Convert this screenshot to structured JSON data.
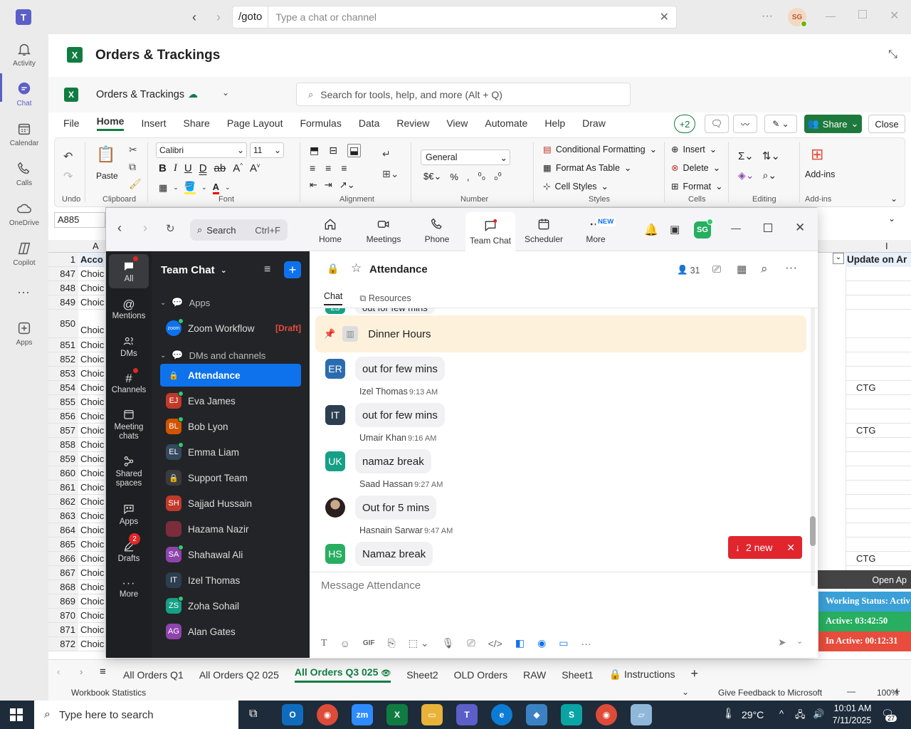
{
  "teams": {
    "search_prefix": "/goto",
    "search_placeholder": "Type a chat or channel",
    "user_initials": "SG",
    "rail": [
      {
        "label": "Activity",
        "icon": "bell-icon"
      },
      {
        "label": "Chat",
        "icon": "chat-icon"
      },
      {
        "label": "Calendar",
        "icon": "calendar-icon"
      },
      {
        "label": "Calls",
        "icon": "phone-icon"
      },
      {
        "label": "OneDrive",
        "icon": "cloud-icon"
      },
      {
        "label": "Copilot",
        "icon": "copilot-icon"
      },
      {
        "label": "Apps",
        "icon": "plus-box-icon"
      }
    ]
  },
  "excel": {
    "window_title": "Orders & Trackings",
    "doc_title": "Orders & Trackings",
    "search_placeholder": "Search for tools, help, and more (Alt + Q)",
    "menu_tabs": [
      "File",
      "Home",
      "Insert",
      "Share",
      "Page Layout",
      "Formulas",
      "Data",
      "Review",
      "View",
      "Automate",
      "Help",
      "Draw"
    ],
    "collab_count": "+2",
    "share_label": "Share",
    "close_label": "Close",
    "ribbon": {
      "undo_label": "Undo",
      "clipboard_label": "Clipboard",
      "paste_label": "Paste",
      "font_label": "Font",
      "font_name": "Calibri",
      "font_size": "11",
      "alignment_label": "Alignment",
      "number_format": "General",
      "number_label": "Number",
      "conditional_formatting": "Conditional Formatting",
      "format_as_table": "Format As Table",
      "cell_styles": "Cell Styles",
      "styles_label": "Styles",
      "insert": "Insert",
      "delete": "Delete",
      "format": "Format",
      "cells_label": "Cells",
      "editing_label": "Editing",
      "addins": "Add-ins",
      "addins_label": "Add-ins"
    },
    "name_box": "A885",
    "col_a": "A",
    "col_i": "I",
    "row1_num": "1",
    "row1_a": "Acco",
    "row1_i": "Update on Ar",
    "rows": [
      {
        "n": "847",
        "a": "Choic",
        "i": ""
      },
      {
        "n": "848",
        "a": "Choic",
        "i": ""
      },
      {
        "n": "849",
        "a": "Choic",
        "i": ""
      },
      {
        "n": "850",
        "a": "Choic",
        "i": ""
      },
      {
        "n": "851",
        "a": "Choic",
        "i": ""
      },
      {
        "n": "852",
        "a": "Choic",
        "i": ""
      },
      {
        "n": "853",
        "a": "Choic",
        "i": ""
      },
      {
        "n": "854",
        "a": "Choic",
        "i": "CTG"
      },
      {
        "n": "855",
        "a": "Choic",
        "i": ""
      },
      {
        "n": "856",
        "a": "Choic",
        "i": ""
      },
      {
        "n": "857",
        "a": "Choic",
        "i": "CTG"
      },
      {
        "n": "858",
        "a": "Choic",
        "i": ""
      },
      {
        "n": "859",
        "a": "Choic",
        "i": ""
      },
      {
        "n": "860",
        "a": "Choic",
        "i": ""
      },
      {
        "n": "861",
        "a": "Choic",
        "i": ""
      },
      {
        "n": "862",
        "a": "Choic",
        "i": ""
      },
      {
        "n": "863",
        "a": "Choic",
        "i": ""
      },
      {
        "n": "864",
        "a": "Choic",
        "i": ""
      },
      {
        "n": "865",
        "a": "Choic",
        "i": ""
      },
      {
        "n": "866",
        "a": "Choic",
        "i": "CTG"
      },
      {
        "n": "867",
        "a": "Choic",
        "i": ""
      },
      {
        "n": "868",
        "a": "Choic",
        "i": ""
      },
      {
        "n": "869",
        "a": "Choic",
        "i": ""
      },
      {
        "n": "870",
        "a": "Choic",
        "i": ""
      },
      {
        "n": "871",
        "a": "Choic",
        "i": ""
      },
      {
        "n": "872",
        "a": "Choic",
        "i": ""
      }
    ],
    "open_app": "Open Ap",
    "working_status": "Working Status: Activ",
    "active_time": "Active: 03:42:50",
    "inactive_time": "In Active: 00:12:31",
    "sheets": [
      "All Orders Q1",
      "All Orders Q2 025",
      "All Orders Q3 025",
      "Sheet2",
      "OLD Orders",
      "RAW",
      "Sheet1",
      "Instructions"
    ],
    "status_left": "Workbook Statistics",
    "feedback": "Give Feedback to Microsoft",
    "zoom_level": "100%",
    "colors": {
      "excel_green": "#107c41",
      "share_green": "#1e7a3c"
    }
  },
  "zoom": {
    "search_label": "Search",
    "search_shortcut": "Ctrl+F",
    "nav": [
      {
        "label": "Home",
        "icon": "home-icon"
      },
      {
        "label": "Meetings",
        "icon": "video-icon"
      },
      {
        "label": "Phone",
        "icon": "phone-icon"
      },
      {
        "label": "Team Chat",
        "icon": "chat-icon"
      },
      {
        "label": "Scheduler",
        "icon": "calendar-icon"
      },
      {
        "label": "More",
        "icon": "more-icon"
      }
    ],
    "new_badge": "NEW",
    "user_initials": "SG",
    "rail": {
      "all": "All",
      "mentions": "Mentions",
      "dms": "DMs",
      "channels": "Channels",
      "meeting_chats": "Meeting chats",
      "shared_spaces": "Shared spaces",
      "apps": "Apps",
      "drafts": "Drafts",
      "drafts_count": "2",
      "more": "More"
    },
    "list_title": "Team Chat",
    "section_apps": "Apps",
    "zoom_workflow": "Zoom Workflow",
    "zoom_logo_text": "zoom",
    "draft_tag": "[Draft]",
    "section_dms": "DMs and channels",
    "contacts": [
      {
        "name": "Attendance",
        "initials": "",
        "color": "#0e72ed"
      },
      {
        "name": "Eva James",
        "initials": "EJ",
        "color": "#c0392b"
      },
      {
        "name": "Bob Lyon",
        "initials": "BL",
        "color": "#d35400"
      },
      {
        "name": "Emma Liam",
        "initials": "EL",
        "color": "#34495e"
      },
      {
        "name": "Support Team",
        "initials": "",
        "color": "#444"
      },
      {
        "name": "Sajjad Hussain",
        "initials": "SH",
        "color": "#c0392b"
      },
      {
        "name": "Hazama Nazir",
        "initials": "",
        "color": "#7b2d3b"
      },
      {
        "name": "Shahawal Ali",
        "initials": "SA",
        "color": "#8e44ad"
      },
      {
        "name": "Izel Thomas",
        "initials": "IT",
        "color": "#2c3e50"
      },
      {
        "name": "Zoha Sohail",
        "initials": "ZS",
        "color": "#16a085"
      },
      {
        "name": "Alan Gates",
        "initials": "AG",
        "color": "#8e44ad"
      }
    ],
    "channel_title": "Attendance",
    "member_count": "31",
    "tabs": [
      "Chat",
      "Resources"
    ],
    "pinned": "Dinner Hours",
    "partial_text": "out for few mins",
    "partial_initials": "ZS",
    "messages": [
      {
        "sender": "",
        "time": "",
        "initials": "ER",
        "color": "#2b6cb0",
        "text": "out for few mins"
      },
      {
        "sender": "Izel Thomas",
        "time": "9:13 AM",
        "initials": "IT",
        "color": "#2c3e50",
        "text": "out for few mins"
      },
      {
        "sender": "Umair Khan",
        "time": "9:16 AM",
        "initials": "UK",
        "color": "#16a085",
        "text": "namaz break"
      },
      {
        "sender": "Saad Hassan",
        "time": "9:27 AM",
        "initials": "",
        "color": "#3a2a2a",
        "text": "Out for 5 mins"
      },
      {
        "sender": "Hasnain Sarwar",
        "time": "9:47 AM",
        "initials": "HS",
        "color": "#27ae60",
        "text": "Namaz break"
      }
    ],
    "new_count_label": "2 new",
    "compose_placeholder": "Message Attendance",
    "gif_label": "GIF"
  },
  "taskbar": {
    "search_placeholder": "Type here to search",
    "temperature": "29°C",
    "time": "10:01 AM",
    "date": "7/11/2025",
    "notif_count": "27"
  }
}
